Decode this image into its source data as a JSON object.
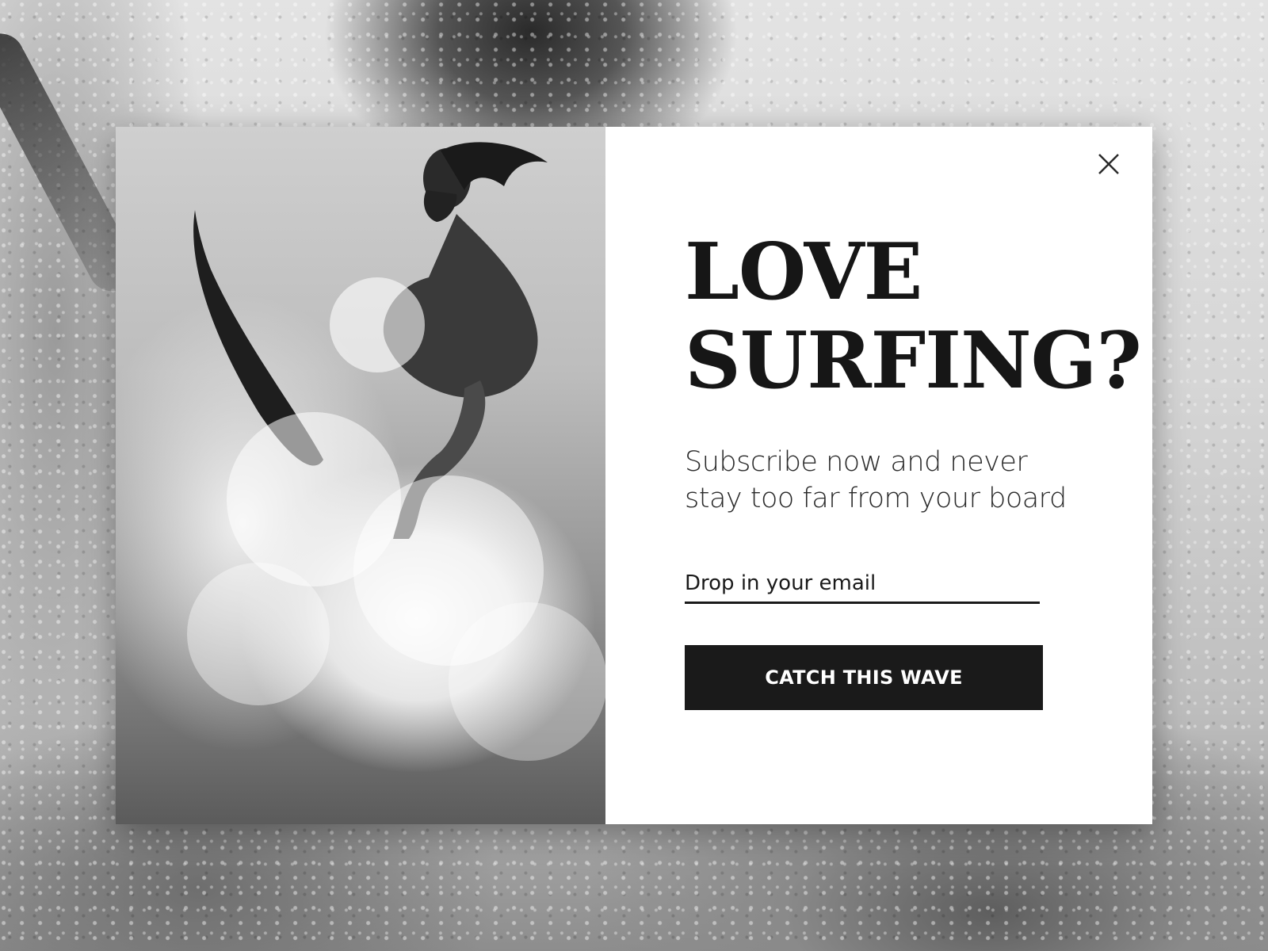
{
  "popup": {
    "headline_line1": "LOVE",
    "headline_line2": "SURFING?",
    "subtitle": "Subscribe now and never stay too far from your board",
    "email_placeholder": "Drop in your email",
    "button_label": "CATCH THIS WAVE"
  },
  "icons": {
    "close": "close-icon"
  },
  "colors": {
    "button_background": "#1a1a1a",
    "button_text": "#ffffff",
    "headline": "#161616",
    "panel_background": "#ffffff"
  }
}
